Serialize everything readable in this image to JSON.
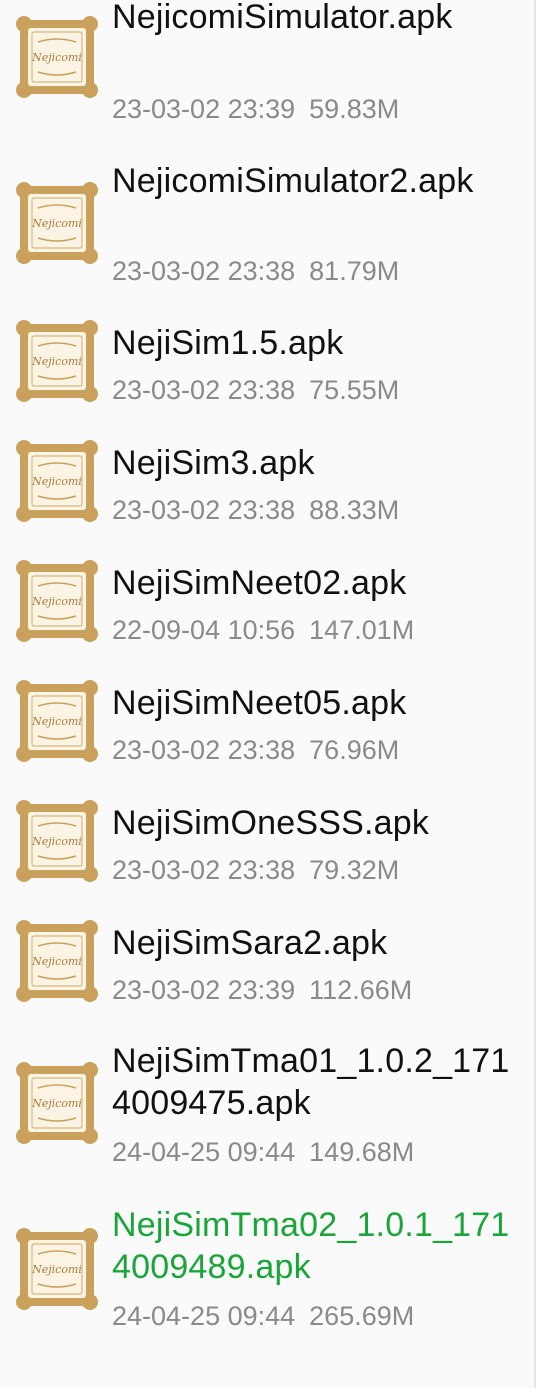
{
  "file_list": {
    "items": [
      {
        "name": "NejicomiSimulator.apk",
        "date": "23-03-02 23:39",
        "size": "59.83M",
        "icon": "nejicomi-app-icon",
        "icon_text": "Nejicomi"
      },
      {
        "name": "NejicomiSimulator2.apk",
        "date": "23-03-02 23:38",
        "size": "81.79M",
        "icon": "nejicomi-app-icon",
        "icon_text": "Nejicomi"
      },
      {
        "name": "NejiSim1.5.apk",
        "date": "23-03-02 23:38",
        "size": "75.55M",
        "icon": "nejicomi-app-icon",
        "icon_text": "Nejicomi"
      },
      {
        "name": "NejiSim3.apk",
        "date": "23-03-02 23:38",
        "size": "88.33M",
        "icon": "nejicomi-app-icon",
        "icon_text": "Nejicomi"
      },
      {
        "name": "NejiSimNeet02.apk",
        "date": "22-09-04 10:56",
        "size": "147.01M",
        "icon": "nejicomi-app-icon",
        "icon_text": "Nejicomi"
      },
      {
        "name": "NejiSimNeet05.apk",
        "date": "23-03-02 23:38",
        "size": "76.96M",
        "icon": "nejicomi-app-icon",
        "icon_text": "Nejicomi"
      },
      {
        "name": "NejiSimOneSSS.apk",
        "date": "23-03-02 23:38",
        "size": "79.32M",
        "icon": "nejicomi-app-icon",
        "icon_text": "Nejicomi"
      },
      {
        "name": "NejiSimSara2.apk",
        "date": "23-03-02 23:39",
        "size": "112.66M",
        "icon": "nejicomi-app-icon",
        "icon_text": "Nejicomi"
      },
      {
        "name": "NejiSimTma01_1.0.2_1714009475.apk",
        "date": "24-04-25 09:44",
        "size": "149.68M",
        "icon": "nejicomi-app-icon",
        "icon_text": "Nejicomi"
      },
      {
        "name": "NejiSimTma02_1.0.1_1714009489.apk",
        "date": "24-04-25 09:44",
        "size": "265.69M",
        "icon": "nejicomi-app-icon",
        "icon_text": "Nejicomi",
        "selected": true
      }
    ]
  },
  "colors": {
    "filename_text": "#111111",
    "meta_text": "#8a8a8a",
    "selected_text": "#1aa53a",
    "icon_gold": "#c9a15c",
    "icon_frame": "#fbf4e4"
  }
}
